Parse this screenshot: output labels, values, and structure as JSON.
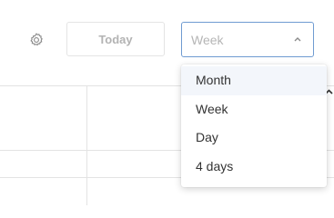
{
  "toolbar": {
    "settings_icon": "gear-icon",
    "today_label": "Today",
    "view_select": {
      "value": "Week",
      "chevron_icon": "chevron-up-icon"
    }
  },
  "dropdown": {
    "items": [
      {
        "label": "Month",
        "highlighted": true
      },
      {
        "label": "Week",
        "highlighted": false
      },
      {
        "label": "Day",
        "highlighted": false
      },
      {
        "label": "4 days",
        "highlighted": false
      }
    ]
  },
  "colors": {
    "select_border": "#6f9bd1",
    "muted_text": "#b3b3b3",
    "grid_line": "#e3e3e3",
    "menu_highlight": "#f3f6fb"
  }
}
